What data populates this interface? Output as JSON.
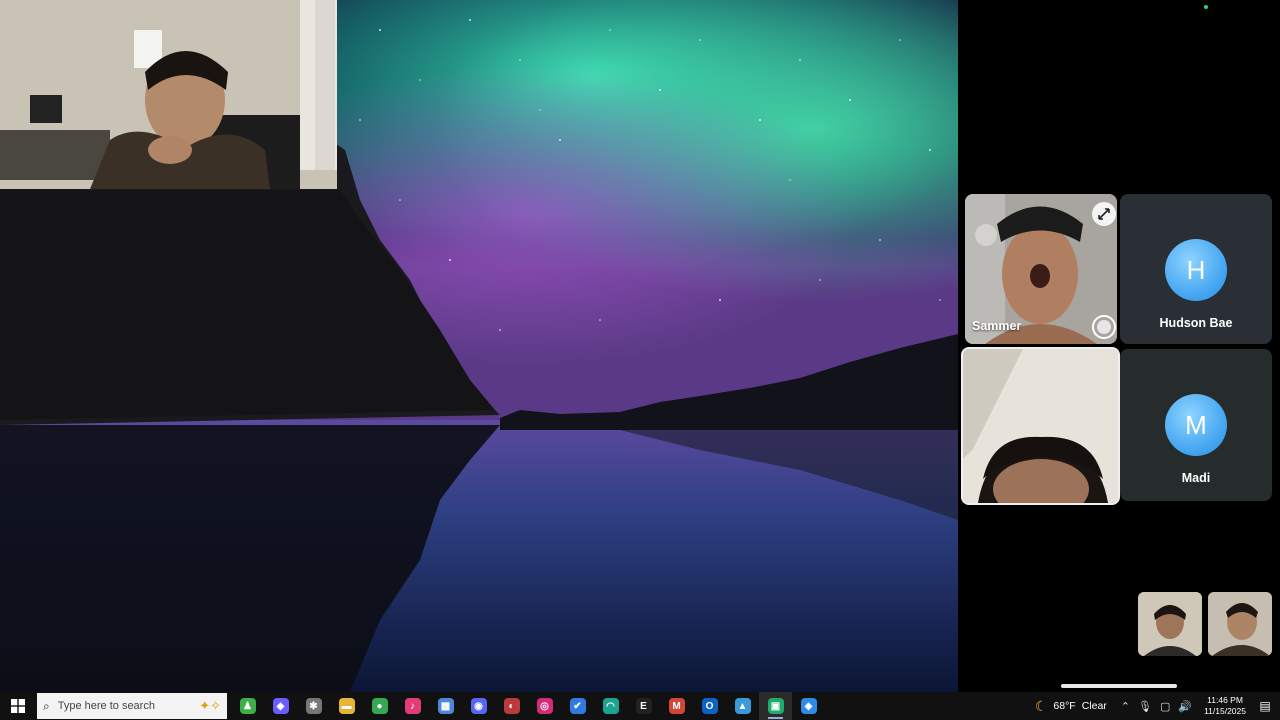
{
  "call": {
    "participants": [
      {
        "name": "Sammer",
        "type": "video"
      },
      {
        "name": "Hudson Bae",
        "type": "avatar",
        "initial": "H"
      },
      {
        "name": "Madi",
        "type": "avatar",
        "initial": "M"
      }
    ]
  },
  "taskbar": {
    "search_placeholder": "Type here to search",
    "apps": [
      {
        "name": "figure-app-icon",
        "color": "#3fae49",
        "glyph": "♟"
      },
      {
        "name": "copilot-icon",
        "color": "#6a5cff",
        "glyph": "◆"
      },
      {
        "name": "puzzle-app-icon",
        "color": "#777777",
        "glyph": "✱"
      },
      {
        "name": "file-explorer-icon",
        "color": "#e8b437",
        "glyph": "▬"
      },
      {
        "name": "chrome-icon",
        "color": "#34a853",
        "glyph": "●"
      },
      {
        "name": "itunes-icon",
        "color": "#e23d79",
        "glyph": "♪"
      },
      {
        "name": "pc-app-icon",
        "color": "#4f87d8",
        "glyph": "▦"
      },
      {
        "name": "discord-icon",
        "color": "#5865f2",
        "glyph": "◉"
      },
      {
        "name": "game-app-icon",
        "color": "#b83a3a",
        "glyph": "◐"
      },
      {
        "name": "instagram-icon",
        "color": "#d62976",
        "glyph": "◎"
      },
      {
        "name": "todo-icon",
        "color": "#2f7be0",
        "glyph": "✔"
      },
      {
        "name": "edge-icon",
        "color": "#1ba590",
        "glyph": "◠"
      },
      {
        "name": "epic-games-icon",
        "color": "#222222",
        "glyph": "E"
      },
      {
        "name": "gmail-icon",
        "color": "#d44638",
        "glyph": "M"
      },
      {
        "name": "outlook-icon",
        "color": "#0a64c4",
        "glyph": "O"
      },
      {
        "name": "photos-app-icon",
        "color": "#3a9ad9",
        "glyph": "▲"
      },
      {
        "name": "phone-link-icon",
        "color": "#1faa6e",
        "glyph": "▣",
        "active": true
      },
      {
        "name": "settings-app-icon",
        "color": "#2e8be8",
        "glyph": "◈"
      }
    ],
    "weather": {
      "temp": "68°F",
      "desc": "Clear"
    },
    "clock": {
      "time": "11:46 PM",
      "date": "11/15/2025"
    }
  }
}
